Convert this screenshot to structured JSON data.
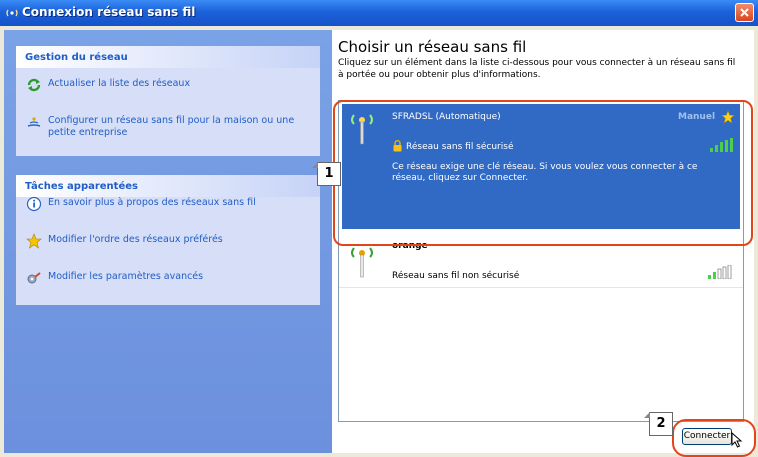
{
  "window": {
    "title": "Connexion réseau sans fil"
  },
  "sidebar": {
    "network_panel": {
      "title": "Gestion du réseau",
      "items": [
        {
          "label": "Actualiser la liste des réseaux",
          "icon": "refresh-icon"
        },
        {
          "label": "Configurer un réseau sans fil pour la maison ou une petite entreprise",
          "icon": "setup-wizard-icon"
        }
      ]
    },
    "related_panel": {
      "title": "Tâches apparentées",
      "items": [
        {
          "label": "En savoir plus à propos des réseaux sans fil",
          "icon": "info-icon"
        },
        {
          "label": "Modifier l'ordre des réseaux préférés",
          "icon": "star-icon"
        },
        {
          "label": "Modifier les paramètres avancés",
          "icon": "settings-icon"
        }
      ]
    }
  },
  "main": {
    "heading": "Choisir un réseau sans fil",
    "instructions": "Cliquez sur un élément dans la liste ci-dessous pour vous connecter à un réseau sans fil à portée ou pour obtenir plus d'informations.",
    "networks": [
      {
        "name": "SFRADSL (Automatique)",
        "mode": "Manuel",
        "security": "Réseau sans fil sécurisé",
        "description": "Ce réseau exige une clé réseau. Si vous voulez vous connecter à ce réseau, cliquez sur Connecter.",
        "selected": true
      },
      {
        "name": "orange",
        "security": "Réseau sans fil non sécurisé",
        "selected": false
      }
    ],
    "connect_label": "Connecter"
  },
  "callouts": {
    "first": "1",
    "second": "2"
  },
  "colors": {
    "title_bar": "#1c61da",
    "selection": "#316ac5",
    "task_link": "#215dc6",
    "highlight_ring": "#e3451a"
  }
}
